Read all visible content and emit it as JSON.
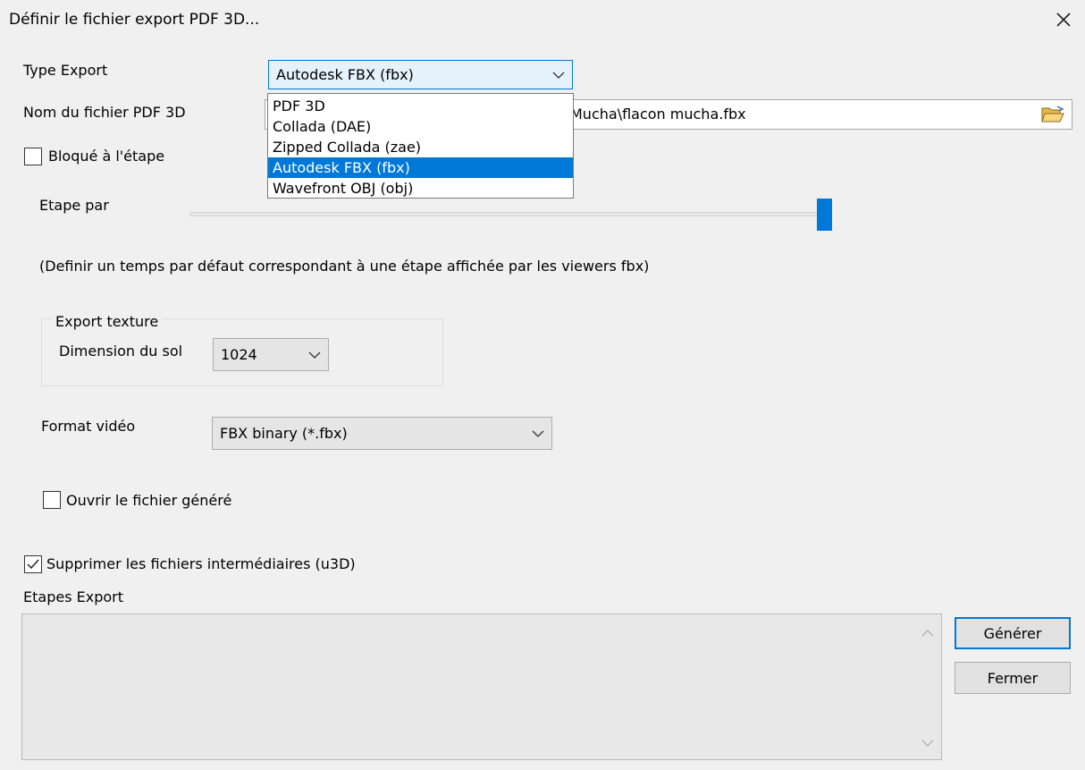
{
  "window": {
    "title": "Définir le fichier export PDF 3D..."
  },
  "type_export": {
    "label": "Type Export",
    "selected": "Autodesk FBX (fbx)",
    "options": [
      "PDF 3D",
      "Collada (DAE)",
      "Zipped Collada (zae)",
      "Autodesk FBX (fbx)",
      "Wavefront OBJ (obj)"
    ],
    "selected_index": 3
  },
  "file_name": {
    "label": "Nom du fichier PDF 3D",
    "visible_value": "Mucha\\flacon mucha.fbx"
  },
  "bloque": {
    "label": "Bloqué à l'étape",
    "checked": false
  },
  "etape": {
    "label": "Etape par",
    "level": 1.0,
    "hint": "(Definir un temps par défaut correspondant à une étape affichée par les viewers fbx)"
  },
  "texture": {
    "group_title": "Export texture",
    "ground_label": "Dimension du sol",
    "ground_value": "1024"
  },
  "video": {
    "label": "Format vidéo",
    "value": "FBX binary (*.fbx)"
  },
  "open_file": {
    "label": "Ouvrir le fichier généré",
    "checked": false
  },
  "delete_intermediate": {
    "label": "Supprimer les fichiers intermédiaires (u3D)",
    "checked": true
  },
  "steps": {
    "label": "Etapes Export"
  },
  "buttons": {
    "generate": "Générer",
    "close": "Fermer"
  },
  "colors": {
    "accent": "#0078d7",
    "background": "#f0f0f0"
  }
}
